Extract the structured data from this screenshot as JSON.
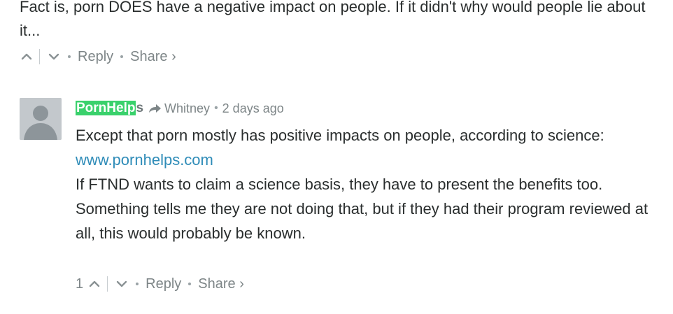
{
  "parent_comment": {
    "text": "Fact is, porn DOES have a negative impact on people. If it didn't why would people lie about it...",
    "actions": {
      "reply": "Reply",
      "share": "Share ›"
    }
  },
  "reply_comment": {
    "author_highlighted": "PornHelp",
    "author_rest": "s",
    "replying_to": "Whitney",
    "separator": "•",
    "timestamp": "2 days ago",
    "paragraph_1": "Except that porn mostly has positive impacts on people, according to science:",
    "link": "www.pornhelps.com",
    "paragraph_2": "If FTND wants to claim a science basis, they have to present the benefits too. Something tells me they are not doing that, but if they had their program reviewed at all, this would probably be known.",
    "upvote_count": "1",
    "actions": {
      "reply": "Reply",
      "share": "Share ›"
    }
  },
  "icons": {
    "upvote": "chevron-up-icon",
    "downvote": "chevron-down-icon",
    "reply_arrow": "share-arrow-icon",
    "avatar": "user-avatar-icon"
  },
  "colors": {
    "highlight": "#3ad16c",
    "link": "#2f8cb8",
    "muted": "#7d8587",
    "text": "#2a2e2e"
  }
}
